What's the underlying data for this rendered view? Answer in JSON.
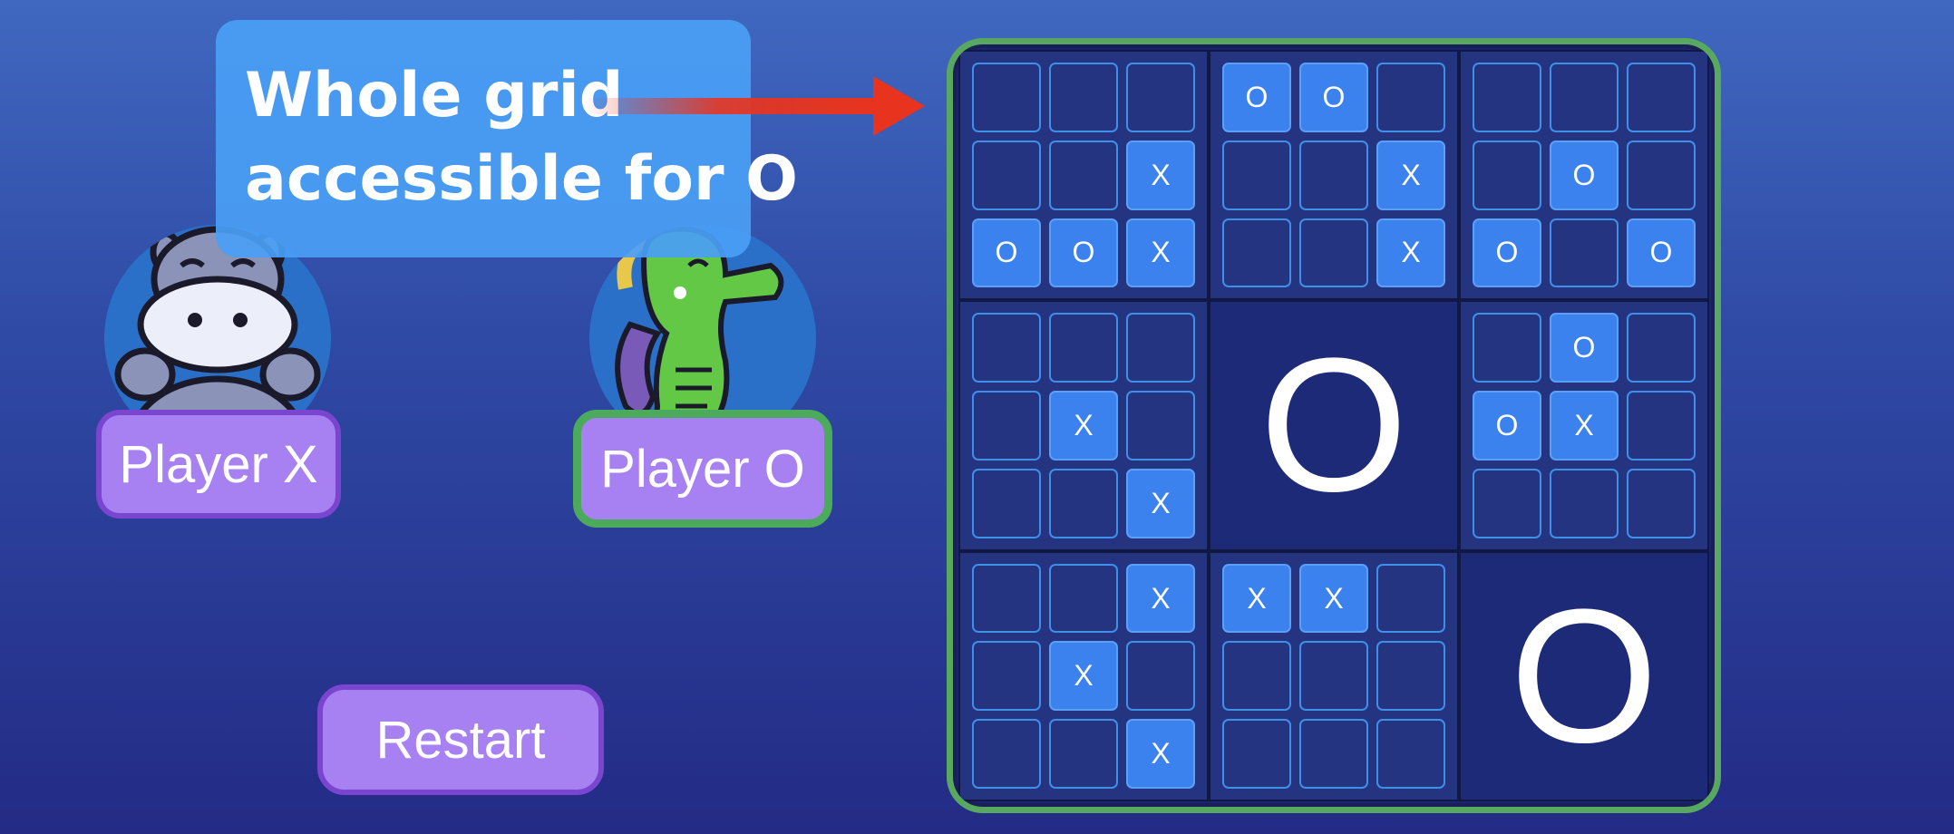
{
  "callout": {
    "line1": "Whole grid",
    "line2": "accessible for O"
  },
  "players": {
    "x_label": "Player X",
    "o_label": "Player O",
    "x_avatar": "hippo-icon",
    "o_avatar": "seahorse-icon",
    "active": "O"
  },
  "restart_label": "Restart",
  "colors": {
    "callout_bg": "#4a9ef5",
    "arrow": "#e8341e",
    "board_border": "#58a95f",
    "cell_filled": "#3b82ef",
    "button_bg": "#a780f2",
    "active_border": "#4caa5c"
  },
  "board": [
    {
      "winner": "",
      "cells": [
        "",
        "",
        "",
        "",
        "",
        "X",
        "O",
        "O",
        "X"
      ]
    },
    {
      "winner": "",
      "cells": [
        "O",
        "O",
        "",
        "",
        "",
        "X",
        "",
        "",
        "X"
      ]
    },
    {
      "winner": "",
      "cells": [
        "",
        "",
        "",
        "",
        "O",
        "",
        "O",
        "",
        "O"
      ]
    },
    {
      "winner": "",
      "cells": [
        "",
        "",
        "",
        "",
        "X",
        "",
        "",
        "",
        "X"
      ]
    },
    {
      "winner": "O",
      "cells": [
        "",
        "",
        "",
        "",
        "",
        "",
        "",
        "",
        ""
      ]
    },
    {
      "winner": "",
      "cells": [
        "",
        "O",
        "",
        "O",
        "X",
        "",
        "",
        "",
        ""
      ]
    },
    {
      "winner": "",
      "cells": [
        "",
        "",
        "X",
        "",
        "X",
        "",
        "",
        "",
        "X"
      ]
    },
    {
      "winner": "",
      "cells": [
        "X",
        "X",
        "",
        "",
        "",
        "",
        "",
        "",
        ""
      ]
    },
    {
      "winner": "O",
      "cells": [
        "",
        "",
        "",
        "",
        "",
        "",
        "",
        "",
        ""
      ]
    }
  ]
}
